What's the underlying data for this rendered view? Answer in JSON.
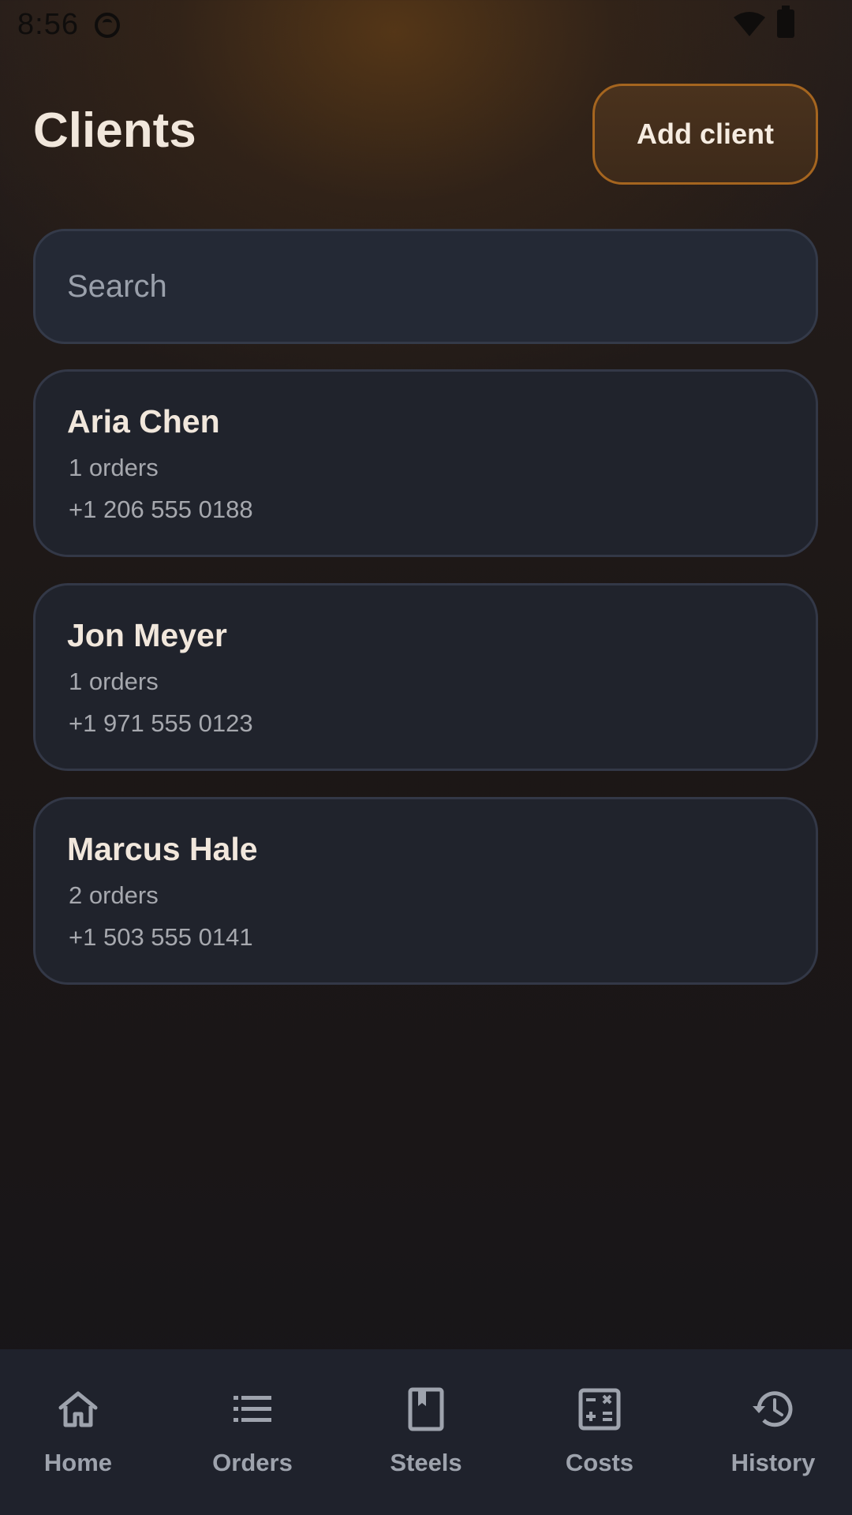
{
  "status_bar": {
    "time": "8:56"
  },
  "header": {
    "title": "Clients",
    "add_button_label": "Add client"
  },
  "search": {
    "placeholder": "Search"
  },
  "clients": [
    {
      "name": "Aria Chen",
      "orders": "1 orders",
      "phone": "+1 206 555 0188"
    },
    {
      "name": "Jon Meyer",
      "orders": "1 orders",
      "phone": "+1 971 555 0123"
    },
    {
      "name": "Marcus Hale",
      "orders": "2 orders",
      "phone": "+1 503 555 0141"
    }
  ],
  "bottom_nav": {
    "items": [
      {
        "label": "Home",
        "icon": "home-icon"
      },
      {
        "label": "Orders",
        "icon": "list-icon"
      },
      {
        "label": "Steels",
        "icon": "bookmark-book-icon"
      },
      {
        "label": "Costs",
        "icon": "calculator-icon"
      },
      {
        "label": "History",
        "icon": "history-icon"
      }
    ]
  },
  "colors": {
    "accent": "#a5651f",
    "card": "#20232c",
    "nav_background": "#1f222c",
    "text_primary": "#f1e7dc",
    "text_secondary": "#a6a8ae"
  }
}
